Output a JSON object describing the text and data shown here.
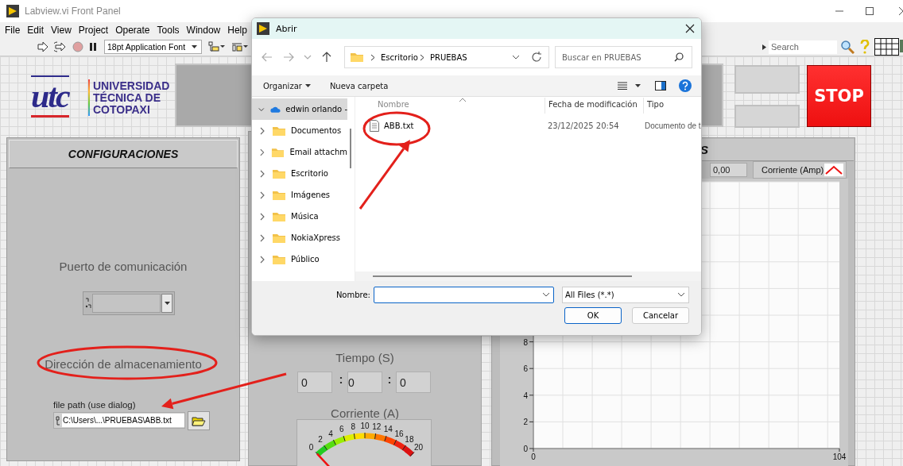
{
  "window": {
    "title": "Labview.vi Front Panel"
  },
  "menu": [
    "File",
    "Edit",
    "View",
    "Project",
    "Operate",
    "Tools",
    "Window",
    "Help"
  ],
  "toolbar": {
    "font": "18pt Application Font",
    "search": {
      "placeholder": "Search"
    }
  },
  "logo": {
    "mark": "utc",
    "lines": [
      "UNIVERSIDAD",
      "TÉCNICA DE",
      "COTOPAXI"
    ]
  },
  "stop_button": {
    "label": "STOP"
  },
  "config_panel": {
    "title": "CONFIGURACIONES",
    "port_label": "Puerto de comunicación",
    "storage_label": "Dirección de almacenamiento",
    "path_label": "file path (use dialog)",
    "path_value": "C:\\Users\\...\\PRUEBAS\\ABB.txt"
  },
  "time_panel": {
    "label": "Tiempo (S)",
    "fields": [
      "0",
      "0",
      "0"
    ],
    "separator": ":"
  },
  "gauge": {
    "label": "Corriente (A)",
    "ticks": [
      "0",
      "2",
      "4",
      "6",
      "8",
      "10",
      "12",
      "14",
      "16",
      "18",
      "20"
    ]
  },
  "chart_panel": {
    "title": "S",
    "value": "0,00",
    "legend": "Corriente (Amp)",
    "chart_data": {
      "type": "line",
      "xlim": [
        0,
        104
      ],
      "ylim": [
        0,
        20
      ],
      "xticks": [
        0,
        104
      ],
      "yticks": [
        0,
        2,
        4,
        6,
        8
      ],
      "grid": true
    }
  },
  "dialog": {
    "title": "Abrir",
    "path": [
      "Escritorio",
      "PRUEBAS"
    ],
    "search": {
      "placeholder": "Buscar en PRUEBAS"
    },
    "commands": [
      "Organizar",
      "Nueva carpeta"
    ],
    "nav": [
      {
        "label": "edwin orlando -",
        "kind": "cloud",
        "selected": true,
        "expanded": true
      },
      {
        "label": "Documentos",
        "kind": "folder",
        "selected": false,
        "expanded": false
      },
      {
        "label": "Email attachm",
        "kind": "folder",
        "selected": false,
        "expanded": false
      },
      {
        "label": "Escritorio",
        "kind": "folder",
        "selected": false,
        "expanded": false
      },
      {
        "label": "Imágenes",
        "kind": "folder",
        "selected": false,
        "expanded": false
      },
      {
        "label": "Música",
        "kind": "folder",
        "selected": false,
        "expanded": false
      },
      {
        "label": "NokiaXpress",
        "kind": "folder",
        "selected": false,
        "expanded": false
      },
      {
        "label": "Público",
        "kind": "folder",
        "selected": false,
        "expanded": false
      }
    ],
    "columns": [
      "Nombre",
      "Fecha de modificación",
      "Tipo"
    ],
    "files": [
      {
        "name": "ABB.txt",
        "modified": "23/12/2025 20:54",
        "type": "Documento de t"
      }
    ],
    "filename_label": "Nombre:",
    "filter": "All Files (*.*)",
    "buttons": [
      "OK",
      "Cancelar"
    ]
  },
  "annotations": [
    {
      "kind": "ellipse"
    },
    {
      "kind": "arrow"
    },
    {
      "kind": "ellipse"
    },
    {
      "kind": "arrow"
    }
  ]
}
